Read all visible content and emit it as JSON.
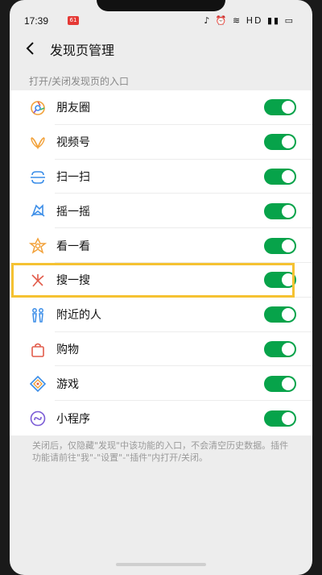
{
  "status_bar": {
    "time": "17:39",
    "badge": "61",
    "icons_text": "♪ ⏰ ≋ HD ▮▮ ▭"
  },
  "navbar": {
    "title": "发现页管理"
  },
  "section_header": "打开/关闭发现页的入口",
  "items": [
    {
      "label": "朋友圈",
      "icon": "moments-icon",
      "enabled": true
    },
    {
      "label": "视频号",
      "icon": "channels-icon",
      "enabled": true
    },
    {
      "label": "扫一扫",
      "icon": "scan-icon",
      "enabled": true
    },
    {
      "label": "摇一摇",
      "icon": "shake-icon",
      "enabled": true
    },
    {
      "label": "看一看",
      "icon": "top-stories-icon",
      "enabled": true
    },
    {
      "label": "搜一搜",
      "icon": "search-icon",
      "enabled": true,
      "highlighted": true
    },
    {
      "label": "附近的人",
      "icon": "people-nearby-icon",
      "enabled": true
    },
    {
      "label": "购物",
      "icon": "shopping-icon",
      "enabled": true
    },
    {
      "label": "游戏",
      "icon": "games-icon",
      "enabled": true
    },
    {
      "label": "小程序",
      "icon": "mini-programs-icon",
      "enabled": true
    }
  ],
  "footer_note": "关闭后，仅隐藏\"发现\"中该功能的入口，不会清空历史数据。插件功能请前往\"我\"-\"设置\"-\"插件\"内打开/关闭。",
  "colors": {
    "toggle_on": "#07a34a",
    "highlight": "#f5c232",
    "background": "#ededed"
  }
}
